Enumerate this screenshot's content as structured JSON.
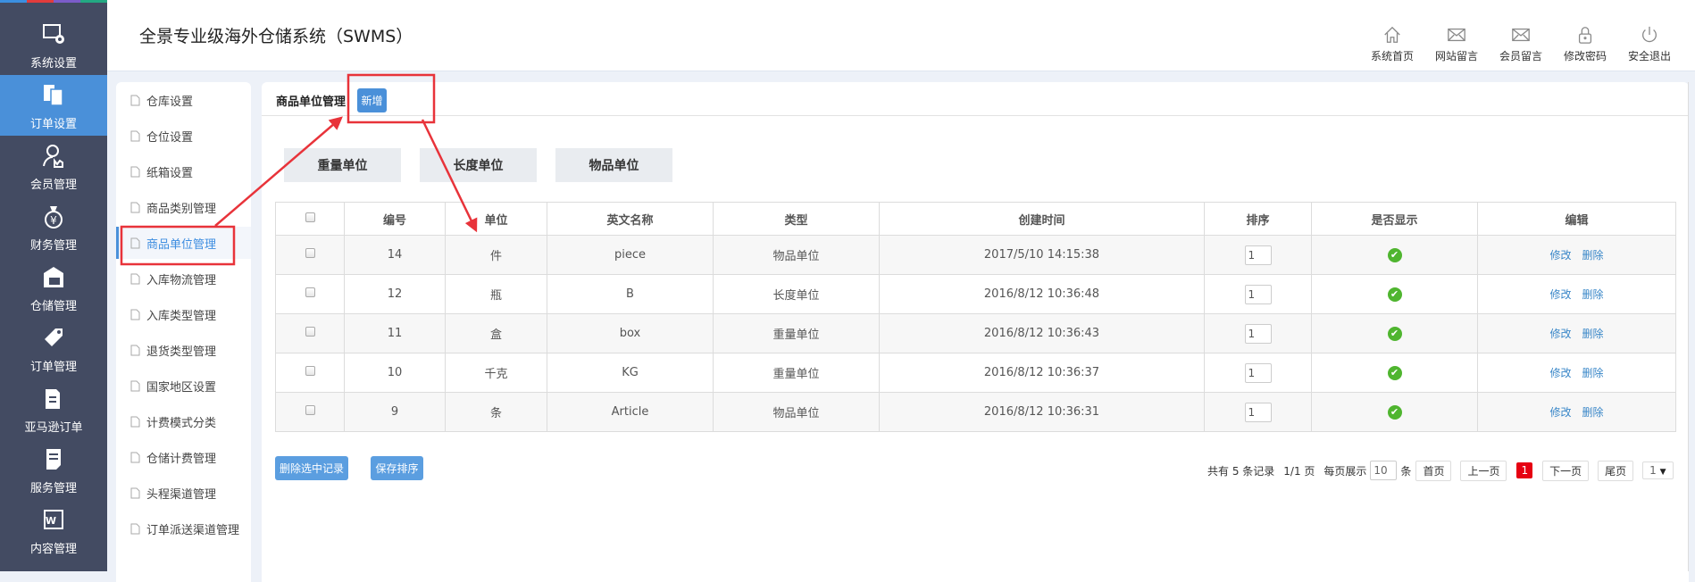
{
  "app": {
    "title": "全景专业级海外仓储系统（SWMS）",
    "strip_colors": [
      "#3b8fe0",
      "#e23c3c",
      "#7b5cc9",
      "#23a883"
    ]
  },
  "sidebar": {
    "items": [
      {
        "label": "系统设置",
        "icon": "monitor-gear-icon"
      },
      {
        "label": "订单设置",
        "icon": "documents-icon",
        "active": true
      },
      {
        "label": "会员管理",
        "icon": "user-icon"
      },
      {
        "label": "财务管理",
        "icon": "money-bag-icon"
      },
      {
        "label": "仓储管理",
        "icon": "warehouse-truck-icon"
      },
      {
        "label": "订单管理",
        "icon": "tag-icon"
      },
      {
        "label": "亚马逊订单",
        "icon": "clipboard-icon"
      },
      {
        "label": "服务管理",
        "icon": "note-icon"
      },
      {
        "label": "内容管理",
        "icon": "word-doc-icon"
      }
    ]
  },
  "toolbar": {
    "items": [
      {
        "label": "系统首页",
        "icon": "home-icon"
      },
      {
        "label": "网站留言",
        "icon": "mail-icon"
      },
      {
        "label": "会员留言",
        "icon": "mail-icon"
      },
      {
        "label": "修改密码",
        "icon": "lock-icon"
      },
      {
        "label": "安全退出",
        "icon": "power-icon"
      }
    ]
  },
  "submenu": {
    "items": [
      "仓库设置",
      "仓位设置",
      "纸箱设置",
      "商品类别管理",
      "商品单位管理",
      "入库物流管理",
      "入库类型管理",
      "退货类型管理",
      "国家地区设置",
      "计费模式分类",
      "仓储计费管理",
      "头程渠道管理",
      "订单派送渠道管理"
    ],
    "active": "商品单位管理"
  },
  "main": {
    "title": "商品单位管理",
    "add_label": "新增",
    "tabs": [
      "重量单位",
      "长度单位",
      "物品单位"
    ],
    "table": {
      "headers": [
        "编号",
        "单位",
        "英文名称",
        "类型",
        "创建时间",
        "排序",
        "是否显示",
        "编辑"
      ],
      "rows": [
        {
          "id": "14",
          "unit": "件",
          "en": "piece",
          "type": "物品单位",
          "created": "2017/5/10 14:15:38",
          "sort": "1",
          "shown": true
        },
        {
          "id": "12",
          "unit": "瓶",
          "en": "B",
          "type": "长度单位",
          "created": "2016/8/12 10:36:48",
          "sort": "1",
          "shown": true
        },
        {
          "id": "11",
          "unit": "盒",
          "en": "box",
          "type": "重量单位",
          "created": "2016/8/12 10:36:43",
          "sort": "1",
          "shown": true
        },
        {
          "id": "10",
          "unit": "千克",
          "en": "KG",
          "type": "重量单位",
          "created": "2016/8/12 10:36:37",
          "sort": "1",
          "shown": true
        },
        {
          "id": "9",
          "unit": "条",
          "en": "Article",
          "type": "物品单位",
          "created": "2016/8/12 10:36:31",
          "sort": "1",
          "shown": true
        }
      ],
      "edit_label": "修改",
      "delete_label": "删除"
    },
    "delete_selected": "删除选中记录",
    "save_sort": "保存排序"
  },
  "pager": {
    "total": "共有 5 条记录",
    "pages": "1/1 页",
    "per_page_label": "每页展示",
    "per_page": "10",
    "unit": "条",
    "first": "首页",
    "prev": "上一页",
    "current": "1",
    "next": "下一页",
    "last": "尾页",
    "select": "1"
  },
  "annotation_color": "#e8333a"
}
